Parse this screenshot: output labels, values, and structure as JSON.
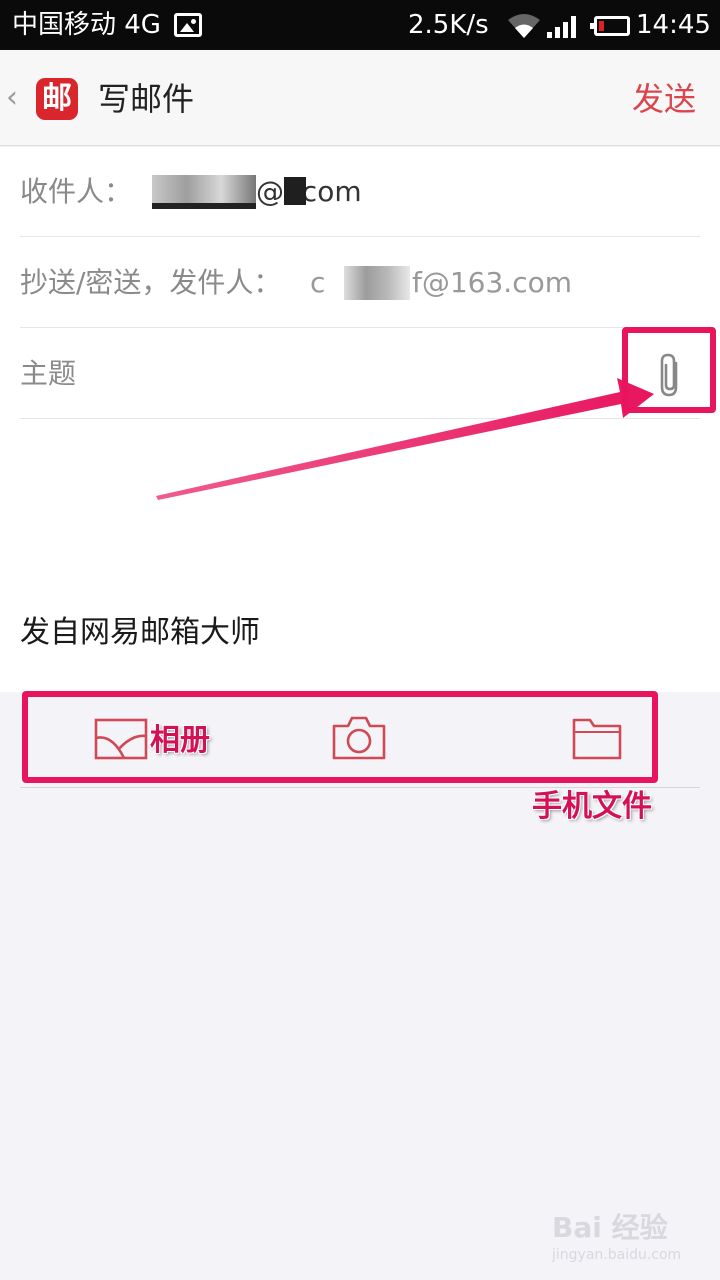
{
  "status_bar": {
    "carrier": "中国移动 4G",
    "speed": "2.5K/s",
    "time": "14:45"
  },
  "header": {
    "back_icon": "‹",
    "logo_text": "邮",
    "title": "写邮件",
    "send_label": "发送"
  },
  "form": {
    "to_label": "收件人：",
    "to_value": "@     .com",
    "cc_label": "抄送/密送，发件人：",
    "cc_prefix": "c",
    "cc_value": "f@163.com",
    "subject_label": "主题",
    "signature": "发自网易邮箱大师"
  },
  "toolbar": {
    "icons": [
      "album-icon",
      "camera-icon",
      "folder-icon"
    ]
  },
  "annotations": {
    "album_label": "相册",
    "files_label": "手机文件",
    "color": "#e8155e"
  },
  "watermark": {
    "brand": "Bai 经验",
    "url": "jingyan.baidu.com"
  },
  "colors": {
    "accent": "#d9464d",
    "status_bar": "#0a0a0a",
    "background": "#f4f3f8"
  }
}
